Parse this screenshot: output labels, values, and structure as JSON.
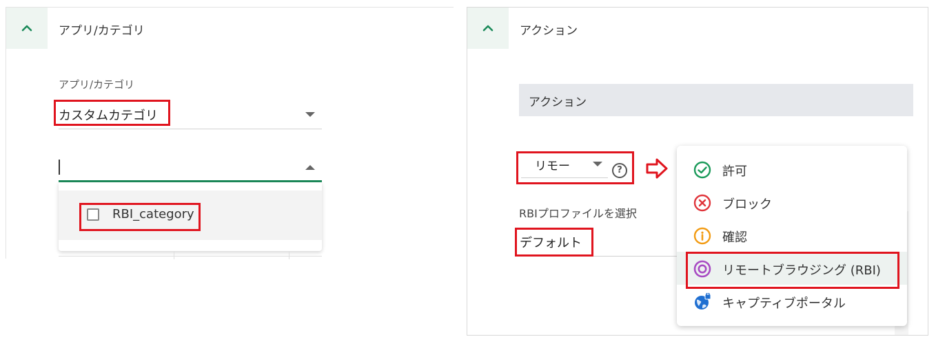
{
  "left": {
    "section_title": "アプリ/カテゴリ",
    "field_label": "アプリ/カテゴリ",
    "select_value": "カスタムカテゴリ",
    "search_value": "",
    "options": [
      "RBI_category"
    ]
  },
  "right": {
    "section_title": "アクション",
    "subheader": "アクション",
    "action_select_value": "リモー",
    "help_symbol": "?",
    "rbi_label": "RBIプロファイルを選択",
    "rbi_value": "デフォルト",
    "menu_items": [
      {
        "label": "許可",
        "icon": "check-circle-icon",
        "color": "#1b9a5a"
      },
      {
        "label": "ブロック",
        "icon": "x-circle-icon",
        "color": "#e0343a"
      },
      {
        "label": "確認",
        "icon": "info-circle-icon",
        "color": "#f29b13"
      },
      {
        "label": "リモートブラウジング (RBI)",
        "icon": "target-circle-icon",
        "color": "#a84bc3"
      },
      {
        "label": "キャプティブポータル",
        "icon": "globe-lock-icon",
        "color": "#1f6fd1"
      }
    ]
  },
  "colors": {
    "highlight_red": "#e0141e",
    "accent_green": "#1b8a5a"
  }
}
